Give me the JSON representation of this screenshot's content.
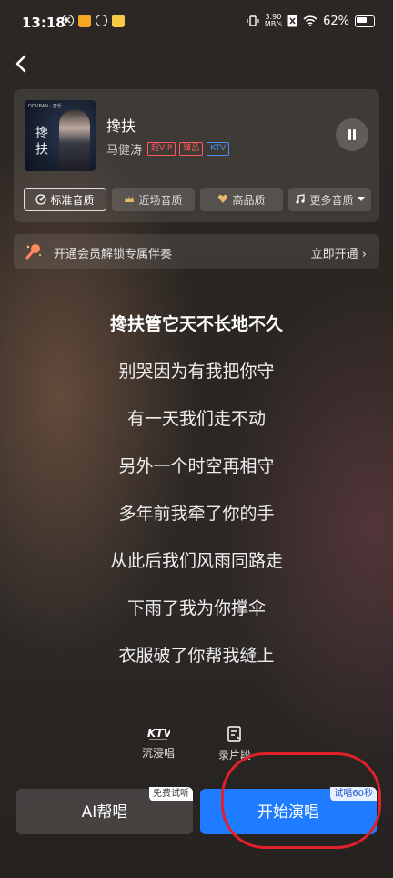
{
  "status_bar": {
    "time": "13:18",
    "speed_top": "3.90",
    "speed_bottom": "MB/s",
    "battery": "62%"
  },
  "song": {
    "title": "搀扶",
    "artist": "马健涛",
    "badges": [
      "超VIP",
      "臻品",
      "KTV"
    ],
    "cover_title": "搀扶",
    "cover_tag": "DOUBAN · 音乐"
  },
  "quality_options": [
    {
      "label": "标准音质",
      "icon": "disc-icon",
      "active": true
    },
    {
      "label": "近场音质",
      "icon": "crown-icon",
      "active": false
    },
    {
      "label": "高品质",
      "icon": "heart-wing-icon",
      "active": false
    },
    {
      "label": "更多音质",
      "icon": "music-note-icon",
      "active": false
    }
  ],
  "vip_bar": {
    "text": "开通会员解锁专属伴奏",
    "link": "立即开通 ›"
  },
  "lyrics": [
    "搀扶管它天不长地不久",
    "别哭因为有我把你守",
    "有一天我们走不动",
    "另外一个时空再相守",
    "多年前我牵了你的手",
    "从此后我们风雨同路走",
    "下雨了我为你撑伞",
    "衣服破了你帮我缝上"
  ],
  "tools": [
    {
      "label": "沉浸唱",
      "icon": "ktv-icon"
    },
    {
      "label": "录片段",
      "icon": "clip-icon"
    }
  ],
  "buttons": {
    "ai_label": "AI帮唱",
    "ai_badge": "免费试听",
    "start_label": "开始演唱",
    "start_badge": "试唱60秒"
  },
  "colors": {
    "accent_blue": "#1f7bff",
    "vip_red": "#ff5a5a",
    "highlight_red": "#e0202a"
  }
}
